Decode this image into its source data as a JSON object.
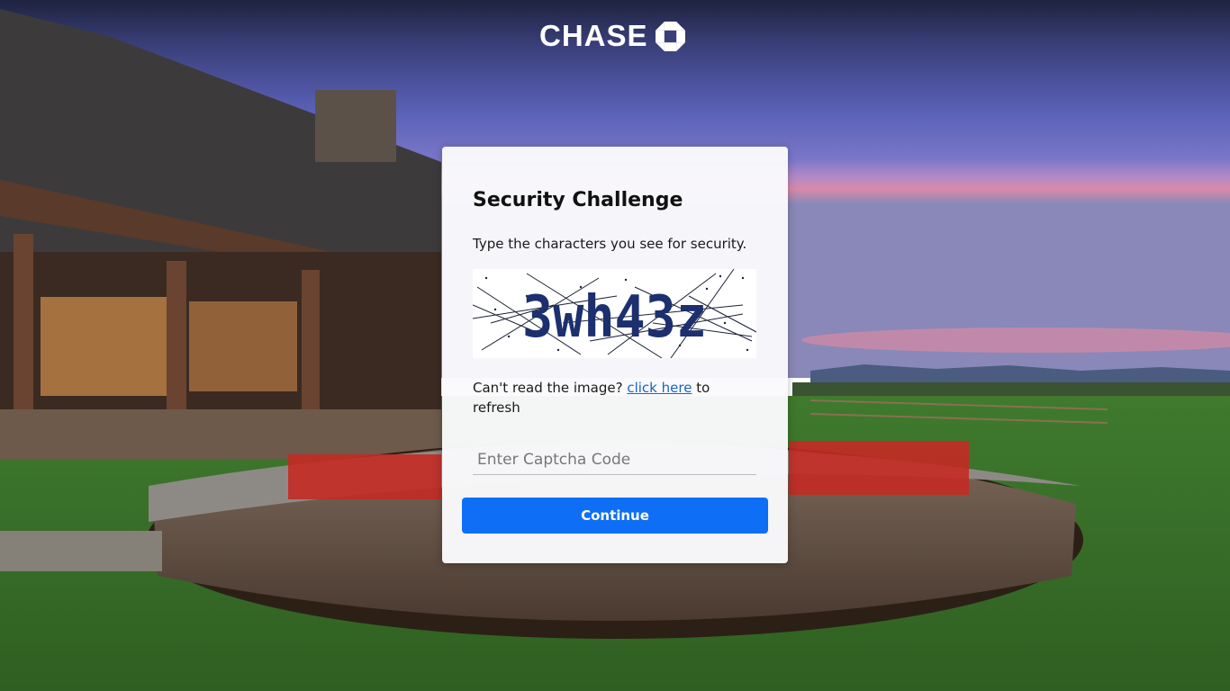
{
  "brand": {
    "name": "CHASE",
    "logo_icon": "chase-octagon-icon"
  },
  "challenge": {
    "title": "Security Challenge",
    "instruction": "Type the characters you see for security.",
    "captcha_text": "3wh43z",
    "refresh_prefix": "Can't read the image?",
    "refresh_link": "click here",
    "refresh_suffix": "to refresh",
    "input_placeholder": "Enter Captcha Code",
    "continue_label": "Continue"
  },
  "colors": {
    "button": "#0f6ef6",
    "link": "#1a63c6",
    "captcha_ink": "#1c2f6e"
  }
}
